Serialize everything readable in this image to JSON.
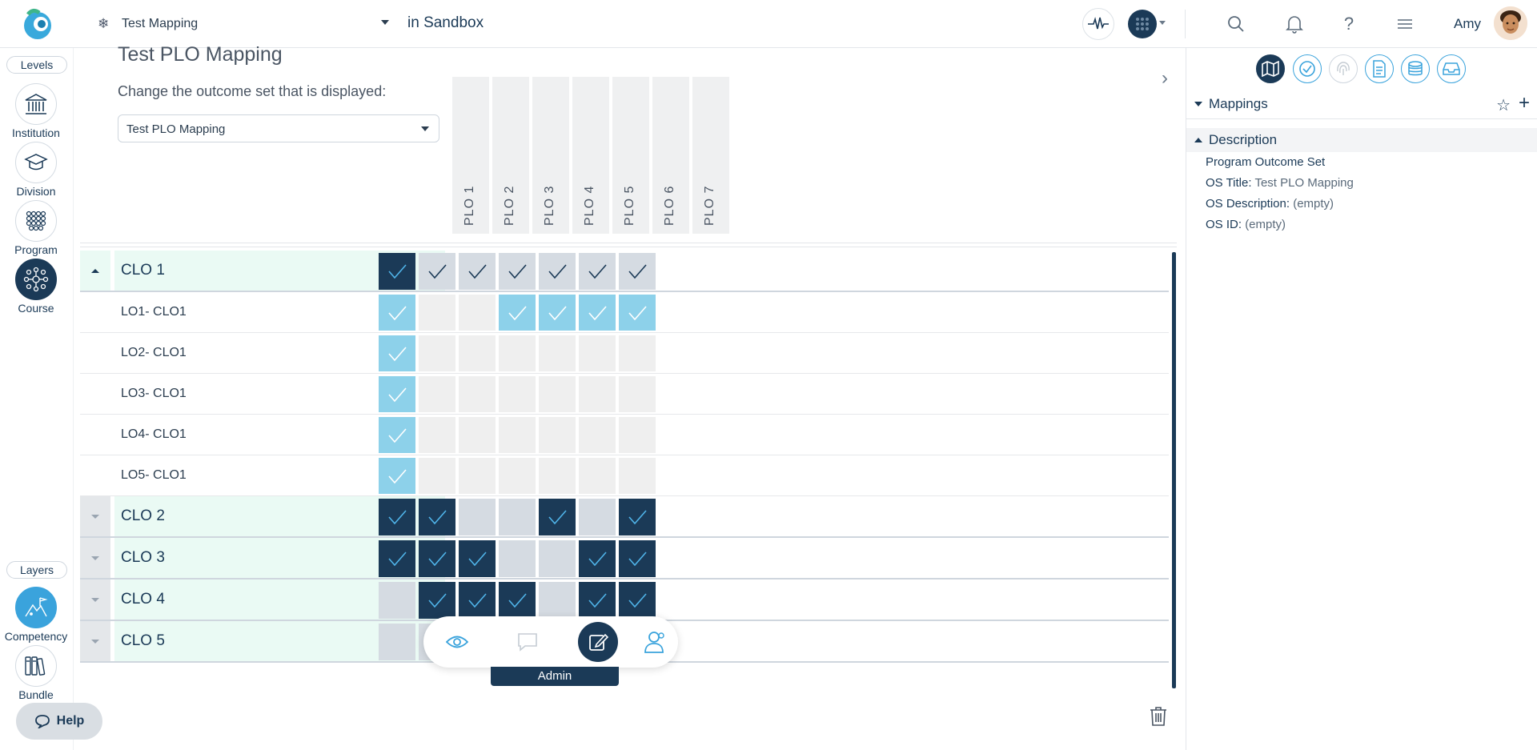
{
  "topbar": {
    "project": "Test Mapping",
    "environment": "in Sandbox",
    "user": "Amy",
    "icons": [
      "activity-icon",
      "apps-grid-icon",
      "search-icon",
      "bell-icon",
      "help-icon",
      "menu-icon"
    ]
  },
  "sidebar": {
    "levels_label": "Levels",
    "levels": [
      {
        "label": "Institution",
        "icon": "institution-icon"
      },
      {
        "label": "Division",
        "icon": "graduation-cap-icon"
      },
      {
        "label": "Program",
        "icon": "program-dots-icon"
      },
      {
        "label": "Course",
        "icon": "course-network-icon",
        "active": true
      }
    ],
    "layers_label": "Layers",
    "layers": [
      {
        "label": "Competency",
        "icon": "competency-mountain-icon",
        "active": true
      },
      {
        "label": "Bundle",
        "icon": "bundle-books-icon"
      }
    ],
    "help": "Help"
  },
  "main": {
    "title": "Test PLO Mapping",
    "change_label": "Change the outcome set that is displayed:",
    "selected_set": "Test PLO Mapping",
    "columns": [
      "PLO 1",
      "PLO 2",
      "PLO 3",
      "PLO 4",
      "PLO 5",
      "PLO 6",
      "PLO 7"
    ],
    "rows": [
      {
        "name": "CLO 1",
        "type": "clo",
        "expanded": true,
        "cells": [
          2,
          1,
          1,
          1,
          1,
          1,
          1
        ]
      },
      {
        "name": "LO1- CLO1",
        "type": "lo",
        "cells": [
          3,
          0,
          0,
          3,
          3,
          3,
          3
        ]
      },
      {
        "name": "LO2- CLO1",
        "type": "lo",
        "cells": [
          3,
          0,
          0,
          0,
          0,
          0,
          0
        ]
      },
      {
        "name": "LO3- CLO1",
        "type": "lo",
        "cells": [
          3,
          0,
          0,
          0,
          0,
          0,
          0
        ]
      },
      {
        "name": "LO4- CLO1",
        "type": "lo",
        "cells": [
          3,
          0,
          0,
          0,
          0,
          0,
          0
        ]
      },
      {
        "name": "LO5- CLO1",
        "type": "lo",
        "cells": [
          3,
          0,
          0,
          0,
          0,
          0,
          0
        ]
      },
      {
        "name": "CLO 2",
        "type": "clo",
        "expanded": false,
        "cells": [
          2,
          2,
          -1,
          -1,
          2,
          -1,
          2
        ]
      },
      {
        "name": "CLO 3",
        "type": "clo",
        "expanded": false,
        "cells": [
          2,
          2,
          2,
          -1,
          -1,
          2,
          2
        ]
      },
      {
        "name": "CLO 4",
        "type": "clo",
        "expanded": false,
        "cells": [
          -1,
          2,
          2,
          2,
          -1,
          2,
          2
        ]
      },
      {
        "name": "CLO 5",
        "type": "clo",
        "expanded": false,
        "cells": [
          -1,
          -1,
          2,
          2,
          2,
          -1,
          2
        ]
      }
    ]
  },
  "bottombar": {
    "buttons": [
      "view-eye-icon",
      "comment-icon",
      "edit-icon",
      "users-icon"
    ],
    "active": "edit-icon",
    "mode_label": "Admin"
  },
  "right_panel": {
    "tabs": [
      "map-icon",
      "check-circle-icon",
      "fingerprint-icon",
      "document-icon",
      "stack-icon",
      "inbox-icon"
    ],
    "mappings_label": "Mappings",
    "description_label": "Description",
    "type_text": "Program Outcome Set",
    "fields": [
      {
        "key": "OS Title:",
        "value": "Test PLO Mapping"
      },
      {
        "key": "OS Description:",
        "value": "(empty)"
      },
      {
        "key": "OS ID:",
        "value": "(empty)"
      }
    ]
  },
  "colors": {
    "navy": "#1b3a57",
    "checked_dark": "#1b3a57",
    "checked_light": "#8dd1ea",
    "unchecked_clo": "#d5dbe2",
    "unchecked_lo": "#efefef",
    "clo_row_bg": "#eafaf4",
    "accent": "#3aa3dc"
  }
}
